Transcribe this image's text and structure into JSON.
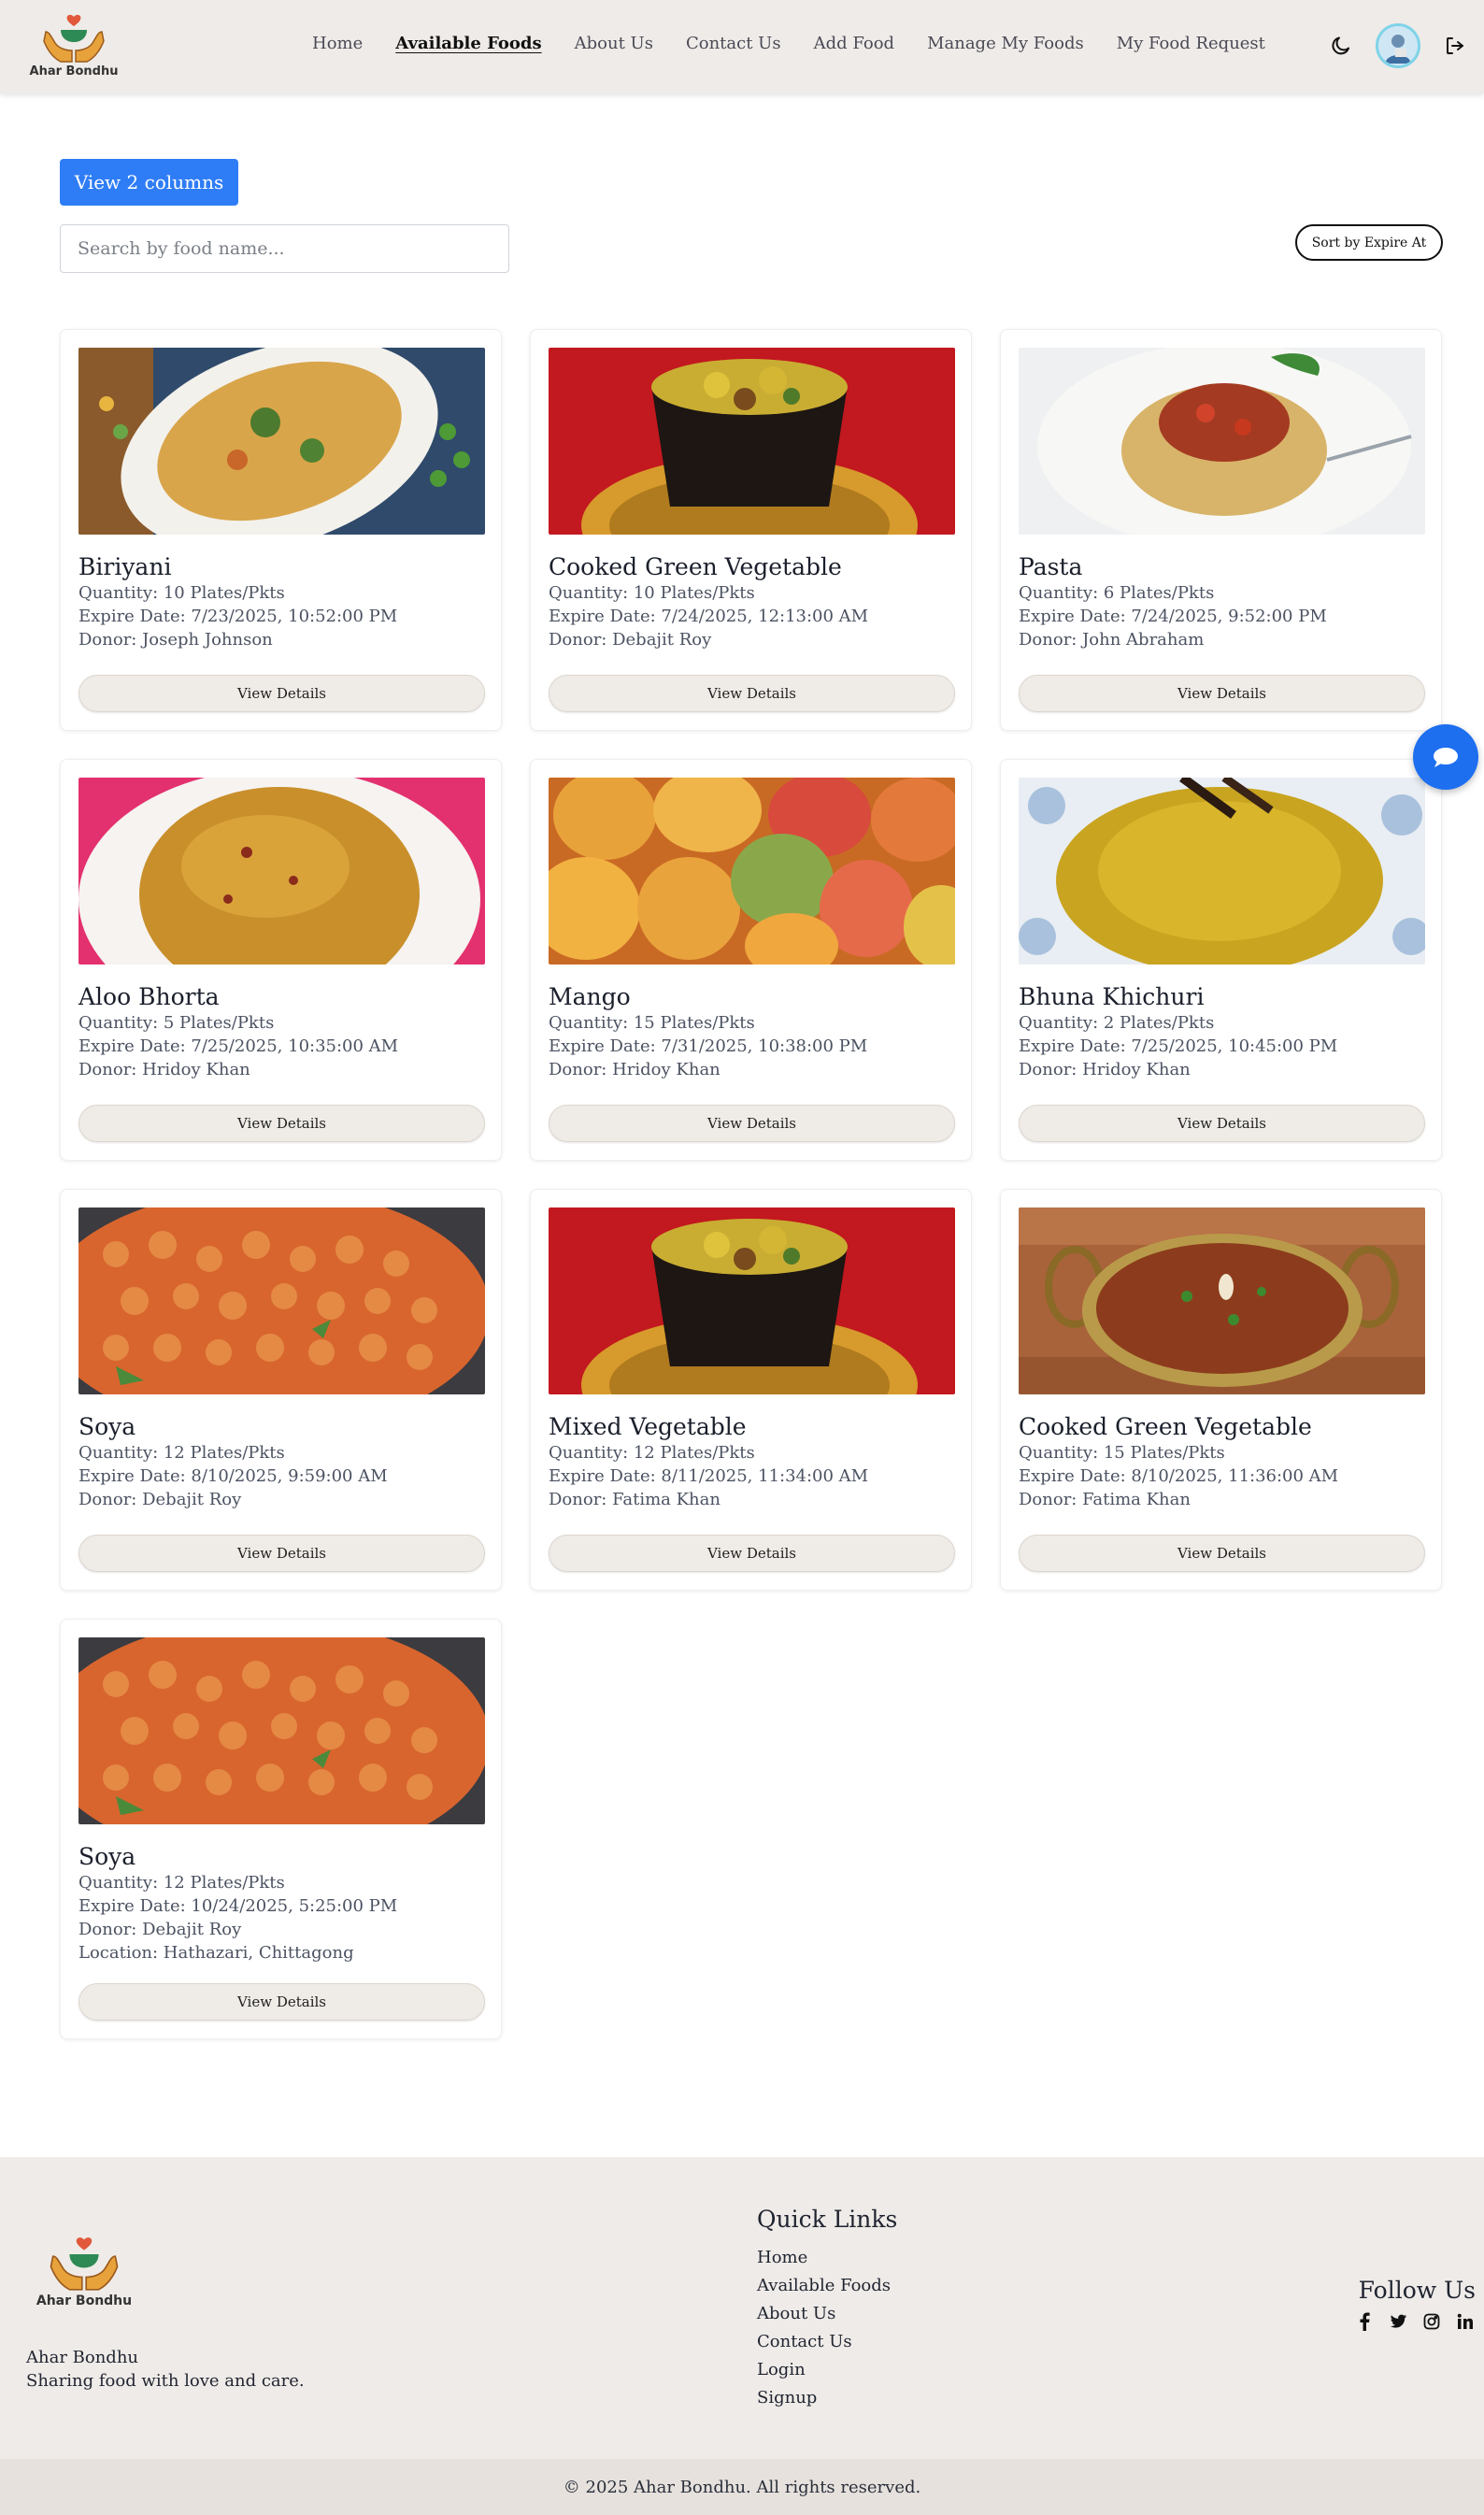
{
  "brand": {
    "name": "Ahar Bondhu"
  },
  "nav": {
    "items": [
      {
        "label": "Home",
        "active": false
      },
      {
        "label": "Available Foods",
        "active": true
      },
      {
        "label": "About Us",
        "active": false
      },
      {
        "label": "Contact Us",
        "active": false
      },
      {
        "label": "Add Food",
        "active": false
      },
      {
        "label": "Manage My Foods",
        "active": false
      },
      {
        "label": "My Food Request",
        "active": false
      }
    ],
    "icons": [
      "moon-icon",
      "avatar",
      "logout-icon"
    ]
  },
  "controls": {
    "view_button": "View 2 columns",
    "search_placeholder": "Search by food name...",
    "search_value": "",
    "sort_button": "Sort by Expire At"
  },
  "foods": [
    {
      "name": "Biriyani",
      "quantity": "Quantity: 10 Plates/Pkts",
      "expire": "Expire Date: 7/23/2025, 10:52:00 PM",
      "donor": "Donor: Joseph Johnson",
      "image": "biriyani"
    },
    {
      "name": "Cooked Green Vegetable",
      "quantity": "Quantity: 10 Plates/Pkts",
      "expire": "Expire Date: 7/24/2025, 12:13:00 AM",
      "donor": "Donor: Debajit Roy",
      "image": "veg-bowl"
    },
    {
      "name": "Pasta",
      "quantity": "Quantity: 6 Plates/Pkts",
      "expire": "Expire Date: 7/24/2025, 9:52:00 PM",
      "donor": "Donor: John Abraham",
      "image": "pasta"
    },
    {
      "name": "Aloo Bhorta",
      "quantity": "Quantity: 5 Plates/Pkts",
      "expire": "Expire Date: 7/25/2025, 10:35:00 AM",
      "donor": "Donor: Hridoy Khan",
      "image": "aloo"
    },
    {
      "name": "Mango",
      "quantity": "Quantity: 15 Plates/Pkts",
      "expire": "Expire Date: 7/31/2025, 10:38:00 PM",
      "donor": "Donor: Hridoy Khan",
      "image": "mango"
    },
    {
      "name": "Bhuna Khichuri",
      "quantity": "Quantity: 2 Plates/Pkts",
      "expire": "Expire Date: 7/25/2025, 10:45:00 PM",
      "donor": "Donor: Hridoy Khan",
      "image": "khichuri"
    },
    {
      "name": "Soya",
      "quantity": "Quantity: 12 Plates/Pkts",
      "expire": "Expire Date: 8/10/2025, 9:59:00 AM",
      "donor": "Donor: Debajit Roy",
      "image": "soya"
    },
    {
      "name": "Mixed Vegetable",
      "quantity": "Quantity: 12 Plates/Pkts",
      "expire": "Expire Date: 8/11/2025, 11:34:00 AM",
      "donor": "Donor: Fatima Khan",
      "image": "veg-bowl"
    },
    {
      "name": "Cooked Green Vegetable",
      "quantity": "Quantity: 15 Plates/Pkts",
      "expire": "Expire Date: 8/10/2025, 11:36:00 AM",
      "donor": "Donor: Fatima Khan",
      "image": "curry"
    },
    {
      "name": "Soya",
      "quantity": "Quantity: 12 Plates/Pkts",
      "expire": "Expire Date: 10/24/2025, 5:25:00 PM",
      "donor": "Donor: Debajit Roy",
      "location": "Location: Hathazari, Chittagong",
      "image": "soya"
    }
  ],
  "card_button": "View Details",
  "footer": {
    "brand_name": "Ahar Bondhu",
    "tagline": "Sharing food with love and care.",
    "quick_links_title": "Quick Links",
    "quick_links": [
      "Home",
      "Available Foods",
      "About Us",
      "Contact Us",
      "Login",
      "Signup"
    ],
    "follow_title": "Follow Us",
    "socials": [
      "facebook-icon",
      "twitter-icon",
      "instagram-icon",
      "linkedin-icon"
    ],
    "copyright": "© 2025 Ahar Bondhu. All rights reserved."
  },
  "colors": {
    "primary": "#2f7df6",
    "nav_bg": "#efebe8",
    "chat": "#1d6ff0"
  }
}
